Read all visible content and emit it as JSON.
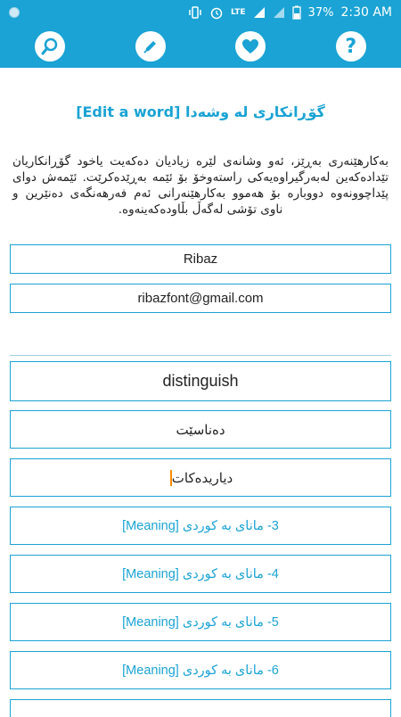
{
  "status_bar": {
    "network": "LTE",
    "battery": "37%",
    "time": "2:30 AM"
  },
  "toolbar": {
    "icons": [
      "search-icon",
      "edit-pencil-icon",
      "heart-icon",
      "help-question-icon"
    ]
  },
  "page": {
    "title_en": "[Edit a word]",
    "title_ku": "گۆڕانکاری لە وشەدا",
    "intro": "بەکارهێنەری بەڕێز، ئەو وشانەی لێرە زیادیان دەکەیت یاخود گۆڕانکاریان تێدادەکەین لەبەرگیراوەیەکی راستەوخۆ بۆ ئێمە بەڕێدەکرێت. ئێمەش دوای پێداچوونەوە دووبارە بۆ هەموو بەکارهێنەرانی ئەم فەرهەنگەی دەنێرین و ناوی تۆشی لەگەڵ بڵاودەکەینەوە."
  },
  "form": {
    "name": "Ribaz",
    "email": "ribazfont@gmail.com",
    "word": "distinguish",
    "kurdish_1": "دەناسێت",
    "kurdish_2": "دیاریدەکات",
    "meanings": [
      "3- مانای بە کوردی [Meaning]",
      "4- مانای بە کوردی [Meaning]",
      "5- مانای بە کوردی [Meaning]",
      "6- مانای بە کوردی [Meaning]"
    ]
  },
  "colors": {
    "accent": "#1aa3d4",
    "caret": "#ff8c00"
  }
}
